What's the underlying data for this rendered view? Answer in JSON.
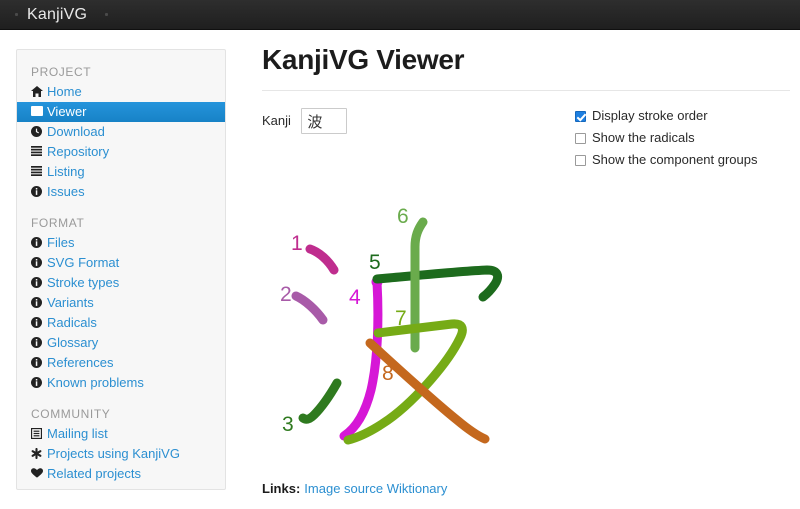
{
  "navbar": {
    "brand": "KanjiVG"
  },
  "sidebar": {
    "groups": [
      {
        "title": "PROJECT",
        "items": [
          {
            "label": "Home",
            "icon": "home-icon",
            "active": false
          },
          {
            "label": "Viewer",
            "icon": "image-icon",
            "active": true
          },
          {
            "label": "Download",
            "icon": "download-clock-icon",
            "active": false
          },
          {
            "label": "Repository",
            "icon": "list-icon",
            "active": false
          },
          {
            "label": "Listing",
            "icon": "list-icon",
            "active": false
          },
          {
            "label": "Issues",
            "icon": "info-circle-icon",
            "active": false
          }
        ]
      },
      {
        "title": "FORMAT",
        "items": [
          {
            "label": "Files",
            "icon": "info-circle-icon",
            "active": false
          },
          {
            "label": "SVG Format",
            "icon": "info-circle-icon",
            "active": false
          },
          {
            "label": "Stroke types",
            "icon": "info-circle-icon",
            "active": false
          },
          {
            "label": "Variants",
            "icon": "info-circle-icon",
            "active": false
          },
          {
            "label": "Radicals",
            "icon": "info-circle-icon",
            "active": false
          },
          {
            "label": "Glossary",
            "icon": "info-circle-icon",
            "active": false
          },
          {
            "label": "References",
            "icon": "info-circle-icon",
            "active": false
          },
          {
            "label": "Known problems",
            "icon": "info-circle-icon",
            "active": false
          }
        ]
      },
      {
        "title": "COMMUNITY",
        "items": [
          {
            "label": "Mailing list",
            "icon": "envelope-list-icon",
            "active": false
          },
          {
            "label": "Projects using KanjiVG",
            "icon": "asterisk-icon",
            "active": false
          },
          {
            "label": "Related projects",
            "icon": "heart-icon",
            "active": false
          }
        ]
      }
    ]
  },
  "main": {
    "title": "KanjiVG Viewer",
    "kanji_field": {
      "label": "Kanji",
      "value": "波",
      "placeholder": ""
    },
    "options": [
      {
        "label": "Display stroke order",
        "checked": true
      },
      {
        "label": "Show the radicals",
        "checked": false
      },
      {
        "label": "Show the component groups",
        "checked": false
      }
    ],
    "links": {
      "label": "Links:",
      "items": [
        "Image source",
        "Wiktionary"
      ]
    }
  },
  "diagram": {
    "character": "波",
    "stroke_count": 8,
    "stroke_numbers": [
      "1",
      "2",
      "3",
      "4",
      "5",
      "6",
      "7",
      "8"
    ],
    "stroke_colors": [
      "#bf2d8e",
      "#a85ba8",
      "#2f7a1f",
      "#d617d6",
      "#1d6b1d",
      "#6aab4c",
      "#76ab16",
      "#c4681e"
    ],
    "number_colors": [
      "#bf2d8e",
      "#a85ba8",
      "#2f7a1f",
      "#d617d6",
      "#1d6b1d",
      "#6aab4c",
      "#76ab16",
      "#c4681e"
    ]
  },
  "theme": {
    "navbar_bg": "#252525",
    "sidebar_bg": "#f7f7f7",
    "link_blue": "#2b8fd1",
    "active_blue": "#1e8ad1",
    "page_bg": "#ffffff"
  }
}
